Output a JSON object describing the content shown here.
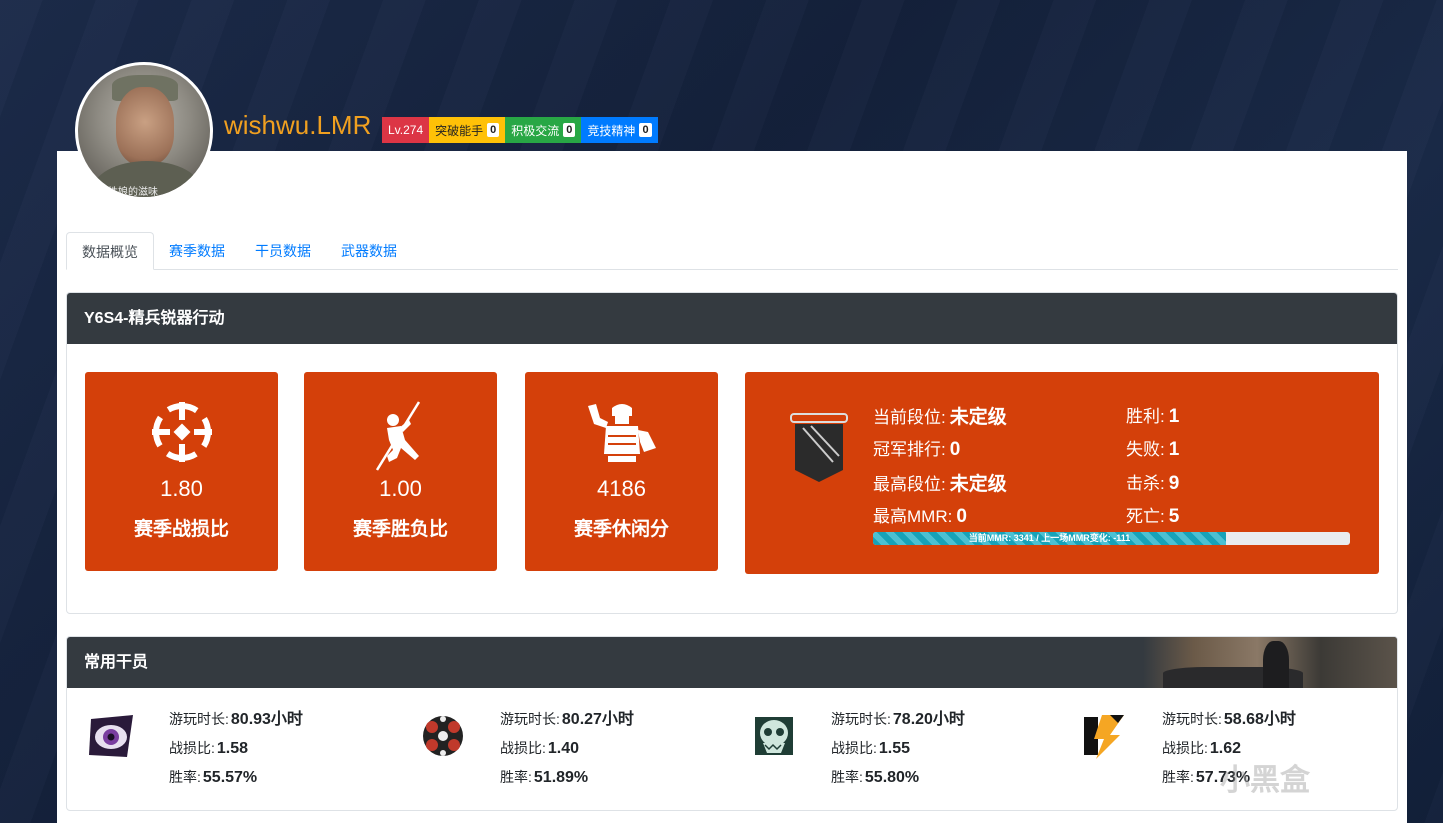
{
  "profile": {
    "username": "wishwu.LMR",
    "avatar_caption": "性娘的滋味"
  },
  "badges": [
    {
      "label": "Lv.274",
      "count": null,
      "color": "#dc3545"
    },
    {
      "label": "突破能手",
      "count": "0",
      "color": "#ffc107"
    },
    {
      "label": "积极交流",
      "count": "0",
      "color": "#28a745"
    },
    {
      "label": "竞技精神",
      "count": "0",
      "color": "#007bff"
    }
  ],
  "tabs": [
    "数据概览",
    "赛季数据",
    "干员数据",
    "武器数据"
  ],
  "season": {
    "title": "Y6S4-精兵锐器行动",
    "stats": [
      {
        "value": "1.80",
        "label": "赛季战损比",
        "icon": "crosshair-icon"
      },
      {
        "value": "1.00",
        "label": "赛季胜负比",
        "icon": "rappel-operator-icon"
      },
      {
        "value": "4186",
        "label": "赛季休闲分",
        "icon": "soldier-flex-icon"
      }
    ],
    "rank": {
      "current_label": "当前段位:",
      "current_value": "未定级",
      "champion_label": "冠军排行:",
      "champion_value": "0",
      "highest_label": "最高段位:",
      "highest_value": "未定级",
      "highest_mmr_label": "最高MMR:",
      "highest_mmr_value": "0",
      "wins_label": "胜利:",
      "wins_value": "1",
      "losses_label": "失败:",
      "losses_value": "1",
      "kills_label": "击杀:",
      "kills_value": "9",
      "deaths_label": "死亡:",
      "deaths_value": "5",
      "mmr_bar_text": "当前MMR: 3341 / 上一场MMR变化: -111",
      "mmr_progress_pct": 74
    }
  },
  "operators": {
    "title": "常用干员",
    "items": [
      {
        "icon": "eye-operator-icon",
        "playtime_label": "游玩时长:",
        "playtime": "80.93小时",
        "kd_label": "战损比:",
        "kd": "1.58",
        "winrate_label": "胜率:",
        "winrate": "55.57%"
      },
      {
        "icon": "gear-operator-icon",
        "playtime_label": "游玩时长:",
        "playtime": "80.27小时",
        "kd_label": "战损比:",
        "kd": "1.40",
        "winrate_label": "胜率:",
        "winrate": "51.89%"
      },
      {
        "icon": "skull-operator-icon",
        "playtime_label": "游玩时长:",
        "playtime": "78.20小时",
        "kd_label": "战损比:",
        "kd": "1.55",
        "winrate_label": "胜率:",
        "winrate": "55.80%"
      },
      {
        "icon": "lightning-operator-icon",
        "playtime_label": "游玩时长:",
        "playtime": "58.68小时",
        "kd_label": "战损比:",
        "kd": "1.62",
        "winrate_label": "胜率:",
        "winrate": "57.73%"
      }
    ]
  },
  "watermark": "小黑盒"
}
